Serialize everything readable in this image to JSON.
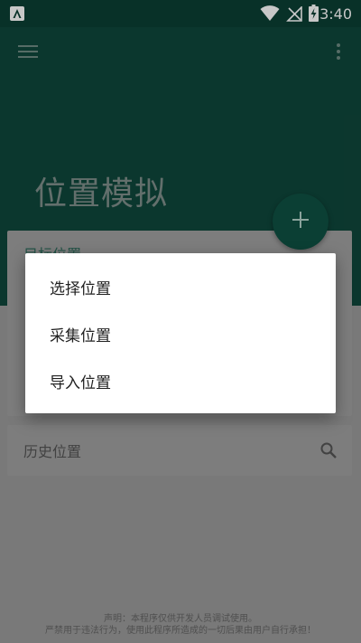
{
  "status_bar": {
    "time": "3:40"
  },
  "page_title": "位置模拟",
  "target_card": {
    "label": "目标位置"
  },
  "popup_menu": {
    "items": [
      "选择位置",
      "采集位置",
      "导入位置"
    ]
  },
  "history_card": {
    "label": "历史位置"
  },
  "footer": {
    "line1": "声明：本程序仅供开发人员调试使用。",
    "line2": "严禁用于违法行为，使用此程序所造成的一切后果由用户自行承担！"
  },
  "colors": {
    "primary_dark": "#0b3f34",
    "primary": "#0f473b",
    "menu_bg": "#ffffff"
  },
  "icons": [
    "app-notification-icon",
    "wifi-icon",
    "no-signal-icon",
    "battery-charging-icon",
    "menu-icon",
    "more-vert-icon",
    "add-icon",
    "search-icon"
  ]
}
